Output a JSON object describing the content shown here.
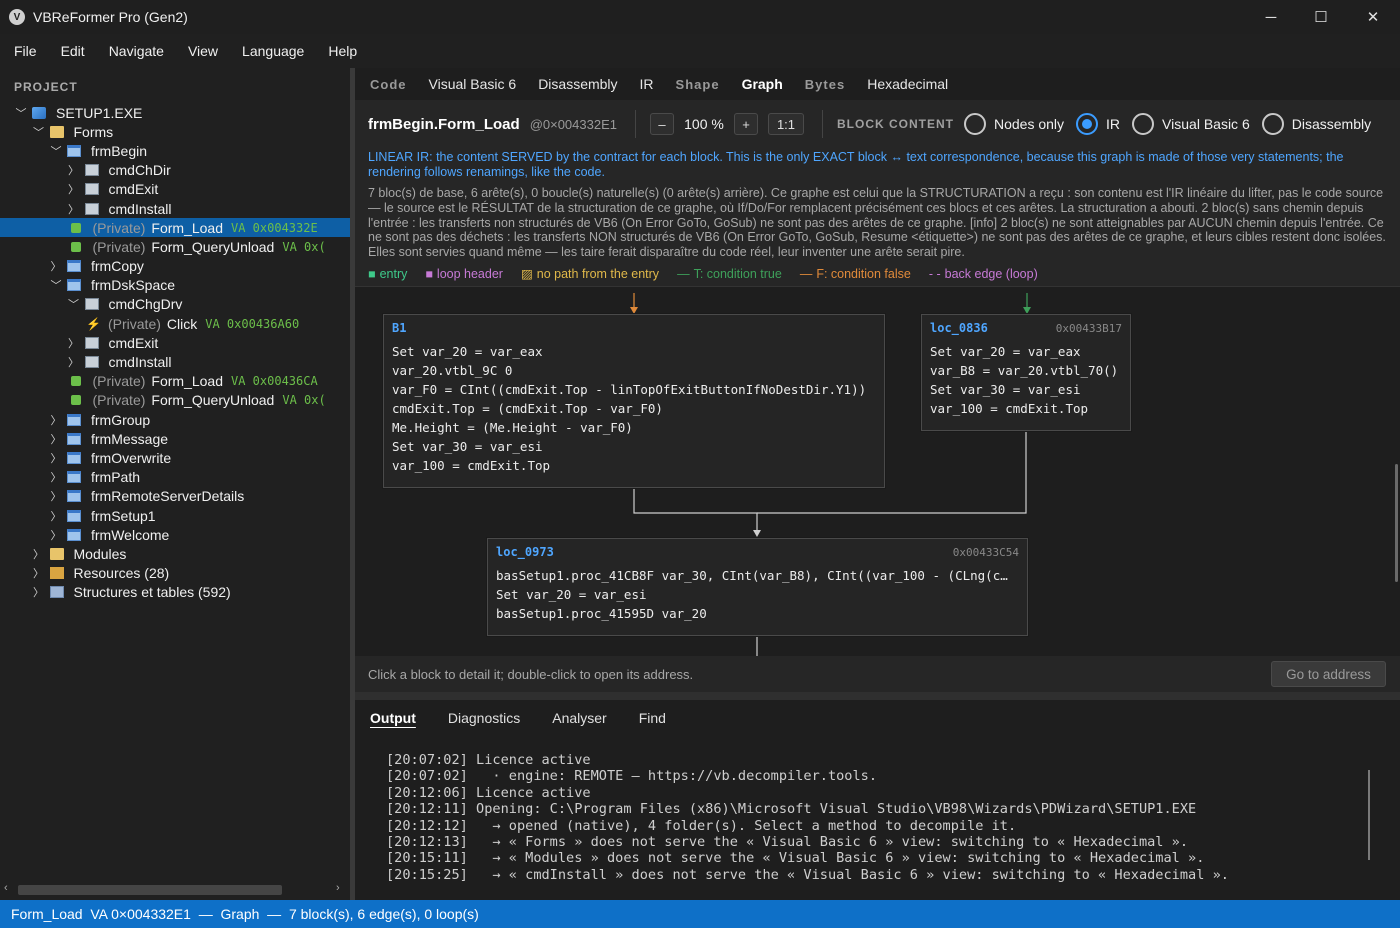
{
  "window": {
    "title": "VBReFormer Pro (Gen2)",
    "icon": "v-logo-icon",
    "minimize": "─",
    "maximize": "☐",
    "close": "✕"
  },
  "menu": [
    "File",
    "Edit",
    "Navigate",
    "View",
    "Language",
    "Help"
  ],
  "project": {
    "label": "PROJECT",
    "tree": [
      {
        "indent": 0,
        "chev": "down",
        "icon": "exe",
        "label": "SETUP1.EXE"
      },
      {
        "indent": 1,
        "chev": "down",
        "icon": "folder",
        "label": "Forms"
      },
      {
        "indent": 2,
        "chev": "down",
        "icon": "form",
        "label": "frmBegin"
      },
      {
        "indent": 3,
        "chev": "right",
        "icon": "ctrl",
        "label": "cmdChDir"
      },
      {
        "indent": 3,
        "chev": "right",
        "icon": "ctrl",
        "label": "cmdExit"
      },
      {
        "indent": 3,
        "chev": "right",
        "icon": "ctrl",
        "label": "cmdInstall"
      },
      {
        "indent": 3,
        "chev": "none",
        "icon": "method",
        "priv": "(Private)",
        "label": "Form_Load",
        "va": "VA 0x004332E",
        "selected": true
      },
      {
        "indent": 3,
        "chev": "none",
        "icon": "method",
        "priv": "(Private)",
        "label": "Form_QueryUnload",
        "va": "VA 0x("
      },
      {
        "indent": 2,
        "chev": "right",
        "icon": "form",
        "label": "frmCopy"
      },
      {
        "indent": 2,
        "chev": "down",
        "icon": "form",
        "label": "frmDskSpace"
      },
      {
        "indent": 3,
        "chev": "down",
        "icon": "ctrl",
        "label": "cmdChgDrv"
      },
      {
        "indent": 4,
        "chev": "none",
        "icon": "event",
        "priv": "(Private)",
        "label": "Click",
        "va": "VA 0x00436A60"
      },
      {
        "indent": 3,
        "chev": "right",
        "icon": "ctrl",
        "label": "cmdExit"
      },
      {
        "indent": 3,
        "chev": "right",
        "icon": "ctrl",
        "label": "cmdInstall"
      },
      {
        "indent": 3,
        "chev": "none",
        "icon": "method",
        "priv": "(Private)",
        "label": "Form_Load",
        "va": "VA 0x00436CA"
      },
      {
        "indent": 3,
        "chev": "none",
        "icon": "method",
        "priv": "(Private)",
        "label": "Form_QueryUnload",
        "va": "VA 0x("
      },
      {
        "indent": 2,
        "chev": "right",
        "icon": "form",
        "label": "frmGroup"
      },
      {
        "indent": 2,
        "chev": "right",
        "icon": "form",
        "label": "frmMessage"
      },
      {
        "indent": 2,
        "chev": "right",
        "icon": "form",
        "label": "frmOverwrite"
      },
      {
        "indent": 2,
        "chev": "right",
        "icon": "form",
        "label": "frmPath"
      },
      {
        "indent": 2,
        "chev": "right",
        "icon": "form",
        "label": "frmRemoteServerDetails"
      },
      {
        "indent": 2,
        "chev": "right",
        "icon": "form",
        "label": "frmSetup1"
      },
      {
        "indent": 2,
        "chev": "right",
        "icon": "form",
        "label": "frmWelcome"
      },
      {
        "indent": 1,
        "chev": "right",
        "icon": "folder",
        "label": "Modules"
      },
      {
        "indent": 1,
        "chev": "right",
        "icon": "res",
        "label": "Resources (28)"
      },
      {
        "indent": 1,
        "chev": "right",
        "icon": "table",
        "label": "Structures et tables (592)"
      }
    ]
  },
  "tabs": [
    {
      "label": "Code",
      "style": "small"
    },
    {
      "label": "Visual Basic 6",
      "style": "normal"
    },
    {
      "label": "Disassembly",
      "style": "normal"
    },
    {
      "label": "IR",
      "style": "normal"
    },
    {
      "label": "Shape",
      "style": "small"
    },
    {
      "label": "Graph",
      "style": "active"
    },
    {
      "label": "Bytes",
      "style": "small"
    },
    {
      "label": "Hexadecimal",
      "style": "normal"
    }
  ],
  "toolbar": {
    "method": "frmBegin.Form_Load",
    "address": "@0×004332E1",
    "zoom_out": "–",
    "zoom": "100 %",
    "zoom_in": "+",
    "reset": "1:1",
    "block_content_label": "BLOCK CONTENT",
    "options": [
      {
        "label": "Nodes only",
        "selected": false
      },
      {
        "label": "IR",
        "selected": true
      },
      {
        "label": "Visual Basic 6",
        "selected": false
      },
      {
        "label": "Disassembly",
        "selected": false
      }
    ]
  },
  "ir_note": "LINEAR IR: the content SERVED by the contract for each block. This is the only EXACT block ↔ text correspondence, because this graph is made of those very statements; the rendering follows renamings, like the code.",
  "description": "7 bloc(s) de base, 6 arête(s), 0 boucle(s) naturelle(s) (0 arête(s) arrière). Ce graphe est celui que la STRUCTURATION a reçu : son contenu est l'IR linéaire du lifter, pas le code source — le source est le RÉSULTAT de la structuration de ce graphe, où If/Do/For remplacent précisément ces blocs et ces arêtes. La structuration a abouti. 2 bloc(s) sans chemin depuis l'entrée : les transferts non structurés de VB6 (On Error GoTo, GoSub) ne sont pas des arêtes de ce graphe.  [info] 2 bloc(s) ne sont atteignables par AUCUN chemin depuis l'entrée. Ce ne sont pas des déchets : les transferts NON structurés de VB6 (On Error GoTo, GoSub, Resume <étiquette>) ne sont pas des arêtes de ce graphe, et leurs cibles restent donc isolées. Elles sont servies quand même — les taire ferait disparaître du code réel, leur inventer une arête serait pire.",
  "legend": [
    {
      "mark": "■",
      "text": "entry",
      "color": "#3ec98a"
    },
    {
      "mark": "■",
      "text": "loop header",
      "color": "#c77ad6"
    },
    {
      "mark": "▨",
      "text": "no path from the entry",
      "color": "#e0b84a"
    },
    {
      "mark": "—",
      "text": "T: condition true",
      "color": "#3ea05a"
    },
    {
      "mark": "—",
      "text": "F: condition false",
      "color": "#e08a3a"
    },
    {
      "mark": "- -",
      "text": "back edge (loop)",
      "color": "#c77ad6"
    }
  ],
  "blocks": {
    "b1": {
      "header": "B1",
      "address": "",
      "lines": [
        "Set var_20 = var_eax",
        "var_20.vtbl_9C 0",
        "var_F0 = CInt((cmdExit.Top - linTopOfExitButtonIfNoDestDir.Y1))",
        "cmdExit.Top = (cmdExit.Top - var_F0)",
        "Me.Height = (Me.Height - var_F0)",
        "Set var_30 = var_esi",
        "var_100 = cmdExit.Top"
      ]
    },
    "loc0836": {
      "header": "loc_0836",
      "address": "0x00433B17",
      "lines": [
        "Set var_20 = var_eax",
        "var_B8 = var_20.vtbl_70()",
        "Set var_30 = var_esi",
        "var_100 = cmdExit.Top"
      ]
    },
    "loc0973": {
      "header": "loc_0973",
      "address": "0x00433C54",
      "lines": [
        "basSetup1.proc_41CB8F var_30, CInt(var_B8), CInt((var_100 - (CLng(c…",
        "Set var_20 = var_esi",
        "basSetup1.proc_41595D var_20"
      ]
    }
  },
  "graph_hint": "Click a block to detail it; double-click to open its address.",
  "goto": "Go to address",
  "output": {
    "tabs": [
      {
        "label": "Output",
        "active": true
      },
      {
        "label": "Diagnostics",
        "active": false
      },
      {
        "label": "Analyser",
        "active": false
      },
      {
        "label": "Find",
        "active": false
      }
    ],
    "log": [
      "[20:07:02] Licence active",
      "[20:07:02]   · engine: REMOTE — https://vb.decompiler.tools.",
      "[20:12:06] Licence active",
      "[20:12:11] Opening: C:\\Program Files (x86)\\Microsoft Visual Studio\\VB98\\Wizards\\PDWizard\\SETUP1.EXE",
      "[20:12:12]   → opened (native), 4 folder(s). Select a method to decompile it.",
      "[20:12:13]   → « Forms » does not serve the « Visual Basic 6 » view: switching to « Hexadecimal ».",
      "[20:15:11]   → « Modules » does not serve the « Visual Basic 6 » view: switching to « Hexadecimal ».",
      "[20:15:25]   → « cmdInstall » does not serve the « Visual Basic 6 » view: switching to « Hexadecimal »."
    ]
  },
  "status": "Form_Load  VA 0×004332E1  —  Graph  —  7 block(s), 6 edge(s), 0 loop(s)"
}
